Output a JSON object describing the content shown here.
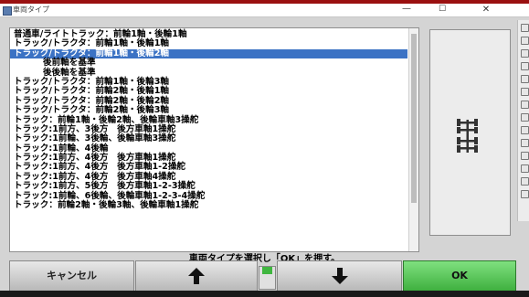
{
  "window": {
    "title": "車両タイプ",
    "minimize_glyph": "—",
    "maximize_glyph": "☐",
    "close_glyph": "✕"
  },
  "vehicle_list": {
    "items": [
      {
        "label": "普通車/ライトトラック：前輪1軸・後輪1軸",
        "indent": false,
        "selected": false
      },
      {
        "label": "トラック/トラクタ：前輪1軸・後輪1軸",
        "indent": false,
        "selected": false
      },
      {
        "label": "トラック/トラクタ：前輪1軸・後輪2軸",
        "indent": false,
        "selected": true
      },
      {
        "label": "後前軸を基準",
        "indent": true,
        "selected": false
      },
      {
        "label": "後後軸を基準",
        "indent": true,
        "selected": false
      },
      {
        "label": "トラック/トラクタ：前輪1軸・後輪3軸",
        "indent": false,
        "selected": false
      },
      {
        "label": "トラック/トラクタ：前輪2軸・後輪1軸",
        "indent": false,
        "selected": false
      },
      {
        "label": "トラック/トラクタ：前輪2軸・後輪2軸",
        "indent": false,
        "selected": false
      },
      {
        "label": "トラック/トラクタ：前輪2軸・後輪3軸",
        "indent": false,
        "selected": false
      },
      {
        "label": "トラック：前輪1軸・後輪2軸、後輪車軸3操舵",
        "indent": false,
        "selected": false
      },
      {
        "label": "トラック:1前方、3後方　後方車軸1操舵",
        "indent": false,
        "selected": false
      },
      {
        "label": "トラック:1前輪、3後輪、後輪車軸3操舵",
        "indent": false,
        "selected": false
      },
      {
        "label": "トラック:1前輪、4後輪",
        "indent": false,
        "selected": false
      },
      {
        "label": "トラック:1前方、4後方　後方車軸1操舵",
        "indent": false,
        "selected": false
      },
      {
        "label": "トラック:1前方、4後方　後方車軸1-2操舵",
        "indent": false,
        "selected": false
      },
      {
        "label": "トラック:1前方、4後方　後方車軸4操舵",
        "indent": false,
        "selected": false
      },
      {
        "label": "トラック:1前方、5後方　後方車軸1-2-3操舵",
        "indent": false,
        "selected": false
      },
      {
        "label": "トラック:1前輪、6後輪、後輪車軸1-2-3-4操舵",
        "indent": false,
        "selected": false
      },
      {
        "label": "トラック：前輪2軸・後輪3軸、後輪車軸1操舵",
        "indent": false,
        "selected": false
      }
    ]
  },
  "preview": {
    "icon": "truck-axle-diagram-icon"
  },
  "instruction_text": "車両タイプを選択し「OK」を押す。",
  "buttons": {
    "cancel_label": "キャンセル",
    "up_icon": "arrow-up-icon",
    "down_icon": "arrow-down-icon",
    "ok_label": "OK"
  },
  "colors": {
    "selection": "#3b72c4",
    "ok_button": "#4cc04c",
    "background_frame": "#9a1010"
  }
}
